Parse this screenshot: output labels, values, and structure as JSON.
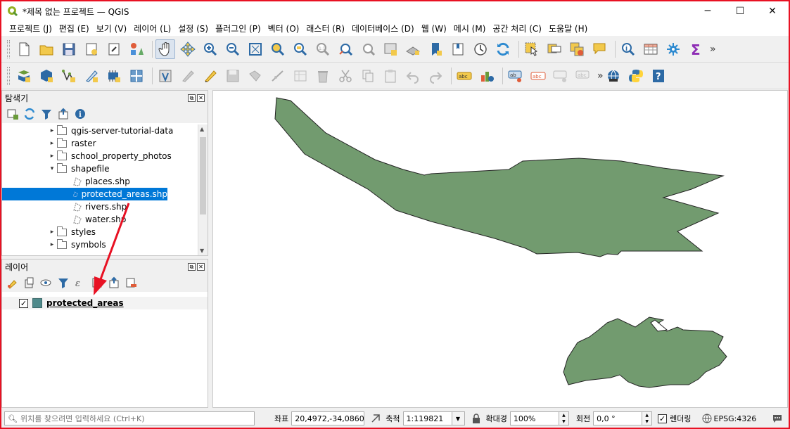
{
  "window": {
    "title": "*제목 없는 프로젝트 — QGIS",
    "minimize": "─",
    "maximize": "☐",
    "close": "✕"
  },
  "menu": [
    "프로젝트 (J)",
    "편집 (E)",
    "보기 (V)",
    "레이어 (L)",
    "설정 (S)",
    "플러그인 (P)",
    "벡터 (O)",
    "래스터 (R)",
    "데이터베이스 (D)",
    "웹 (W)",
    "메시 (M)",
    "공간 처리 (C)",
    "도움말 (H)"
  ],
  "toolbar_overflow": "»",
  "browser_panel": {
    "title": "탐색기",
    "items": [
      {
        "label": "qgis-server-tutorial-data",
        "type": "folder",
        "expander": "▸",
        "level": 1
      },
      {
        "label": "raster",
        "type": "folder",
        "expander": "▸",
        "level": 1
      },
      {
        "label": "school_property_photos",
        "type": "folder",
        "expander": "▸",
        "level": 1
      },
      {
        "label": "shapefile",
        "type": "folder",
        "expander": "▾",
        "level": 1
      },
      {
        "label": "places.shp",
        "type": "shp",
        "expander": "",
        "level": 2
      },
      {
        "label": "protected_areas.shp",
        "type": "shp",
        "expander": "",
        "level": 2,
        "selected": true
      },
      {
        "label": "rivers.shp",
        "type": "shp",
        "expander": "",
        "level": 2
      },
      {
        "label": "water.shp",
        "type": "shp",
        "expander": "",
        "level": 2
      },
      {
        "label": "styles",
        "type": "folder",
        "expander": "▸",
        "level": 1
      },
      {
        "label": "symbols",
        "type": "folder",
        "expander": "▸",
        "level": 1
      }
    ]
  },
  "layers_panel": {
    "title": "레이어",
    "layers": [
      {
        "name": "protected_areas",
        "visible": true,
        "color": "#4f8a8b"
      }
    ]
  },
  "map": {
    "fill_color": "#729b6f",
    "stroke_color": "#232323"
  },
  "statusbar": {
    "locator_placeholder": "위치를 찾으려면 입력하세요 (Ctrl+K)",
    "coord_label": "좌표",
    "coord_value": "20,4972,-34,0860",
    "scale_label": "축척",
    "scale_value": "1:119821",
    "magnifier_label": "확대경",
    "magnifier_value": "100%",
    "rotation_label": "회전",
    "rotation_value": "0,0 °",
    "render_label": "렌더링",
    "render_checked": true,
    "crs": "EPSG:4326"
  },
  "annotation_color": "#e81123"
}
